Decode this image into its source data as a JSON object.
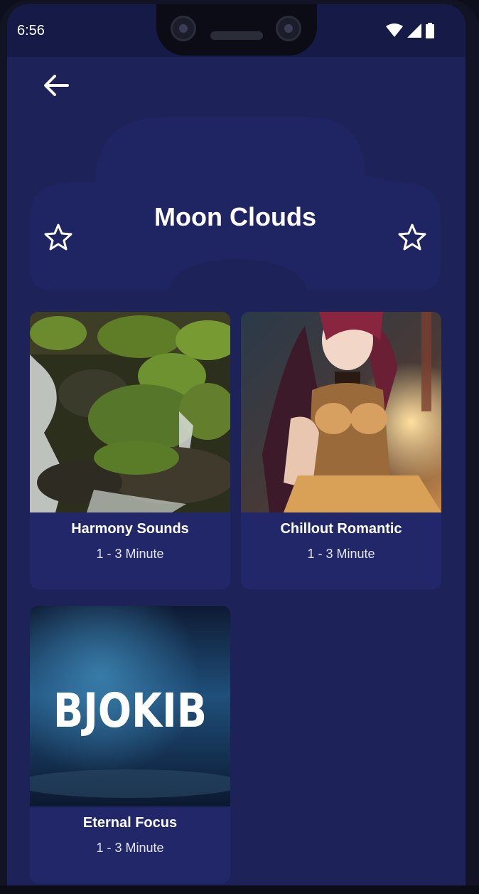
{
  "status_bar": {
    "time": "6:56",
    "icons": [
      "wifi-icon",
      "signal-icon",
      "battery-icon"
    ]
  },
  "header": {
    "back_icon": "arrow-left-icon",
    "moon_icon": "moon-icon",
    "title": "Moon Clouds",
    "star_icons": [
      "star-outline-icon",
      "star-outline-icon"
    ]
  },
  "tracks": [
    {
      "title": "Harmony Sounds",
      "duration": "1 - 3 Minute",
      "image": "mossy-waterfall-image"
    },
    {
      "title": "Chillout Romantic",
      "duration": "1 - 3 Minute",
      "image": "anime-girl-image"
    },
    {
      "title": "Eternal Focus",
      "duration": "1 - 3 Minute",
      "image": "bjokib-night-image",
      "image_text": "BJOKIB"
    }
  ],
  "colors": {
    "background": "#1d2259",
    "card": "#22276a",
    "status_bar": "#161a47",
    "text": "#ffffff"
  }
}
